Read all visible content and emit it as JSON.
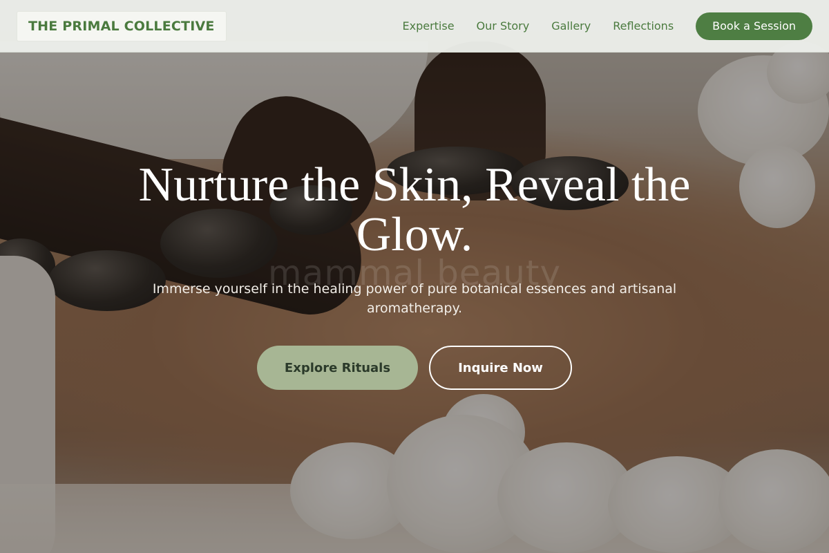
{
  "brand": {
    "name": "THE PRIMAL COLLECTIVE"
  },
  "nav": {
    "links": [
      "Expertise",
      "Our Story",
      "Gallery",
      "Reflections"
    ],
    "cta": "Book a Session"
  },
  "hero": {
    "headline": "Nurture the Skin, Reveal the Glow.",
    "watermark": "mammal beauty",
    "subheadline": "Immerse yourself in the healing power of pure botanical essences and artisanal aromatherapy.",
    "primary_button": "Explore Rituals",
    "secondary_button": "Inquire Now",
    "background_image": "hot-stone-massage-photo"
  },
  "colors": {
    "brand_green": "#4a7a3e",
    "button_green": "#4e7e43",
    "sage": "#a7b694",
    "header_bg": "#eceeea"
  }
}
